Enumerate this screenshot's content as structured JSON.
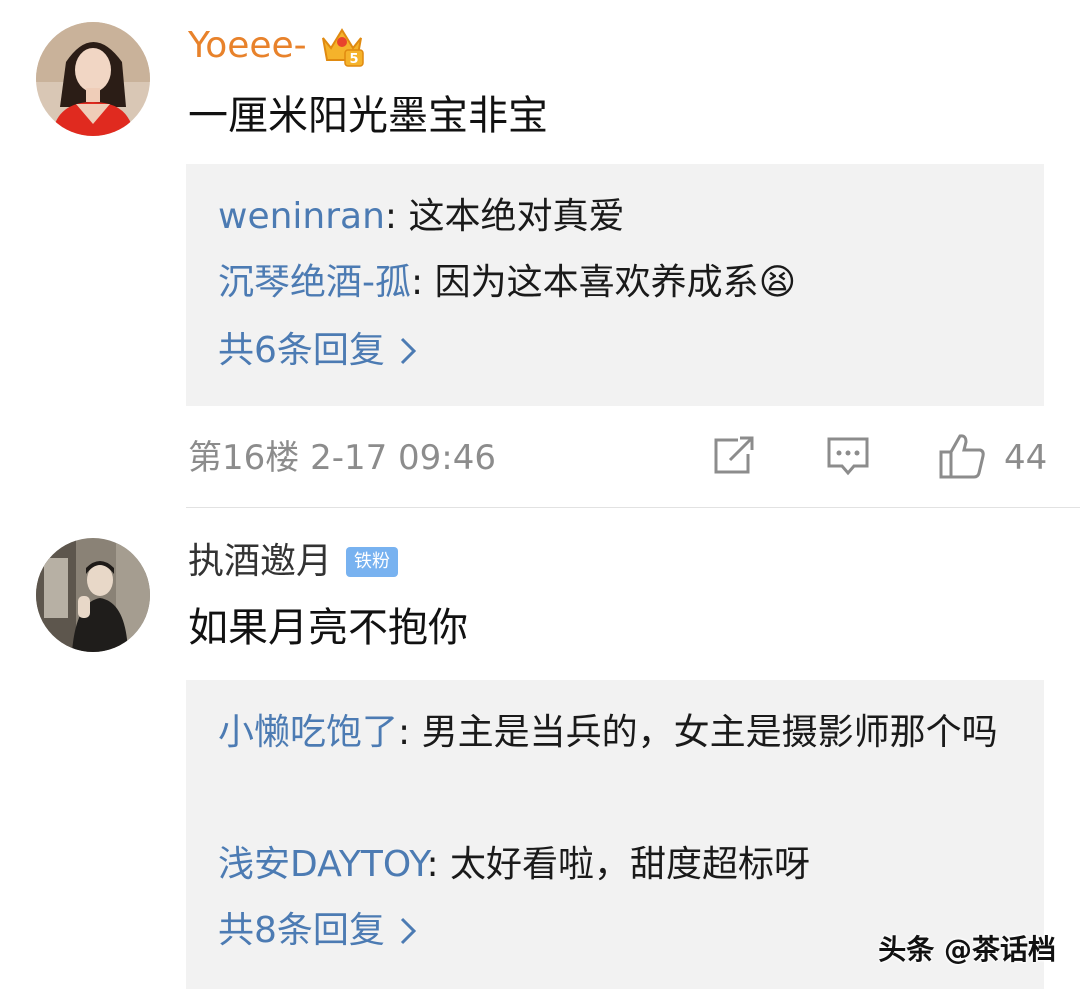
{
  "comments": [
    {
      "username": "Yoeee-",
      "crown_level": "5",
      "content": "一厘米阳光墨宝非宝",
      "replies": [
        {
          "name": "weninran",
          "text": ": 这本绝对真爱"
        },
        {
          "name": "沉琴绝酒-孤",
          "text": ": 因为这本喜欢养成系",
          "emoji": "😫"
        }
      ],
      "more_replies": "共6条回复",
      "floor_time": "第16楼  2-17 09:46",
      "like_count": "44"
    },
    {
      "username": "执酒邀月",
      "fan_badge": "铁粉",
      "content": "如果月亮不抱你",
      "replies": [
        {
          "name": "小懒吃饱了",
          "text": ": 男主是当兵的，女主是摄影师那个吗"
        },
        {
          "name": "浅安DAYTOY",
          "text": ": 太好看啦，甜度超标呀"
        }
      ],
      "more_replies": "共8条回复"
    }
  ],
  "watermark": "头条 @茶话档",
  "icons": {
    "share": "share-icon",
    "comment": "comment-icon",
    "like": "thumbs-up-icon",
    "chevron": "chevron-right-icon",
    "crown": "crown-badge-icon"
  },
  "colors": {
    "link_blue": "#4c7bb3",
    "vip_orange": "#e8822b",
    "fan_badge_blue": "#78b2f0",
    "reply_bg": "#f2f2f2",
    "meta_gray": "#8c8c8c"
  }
}
